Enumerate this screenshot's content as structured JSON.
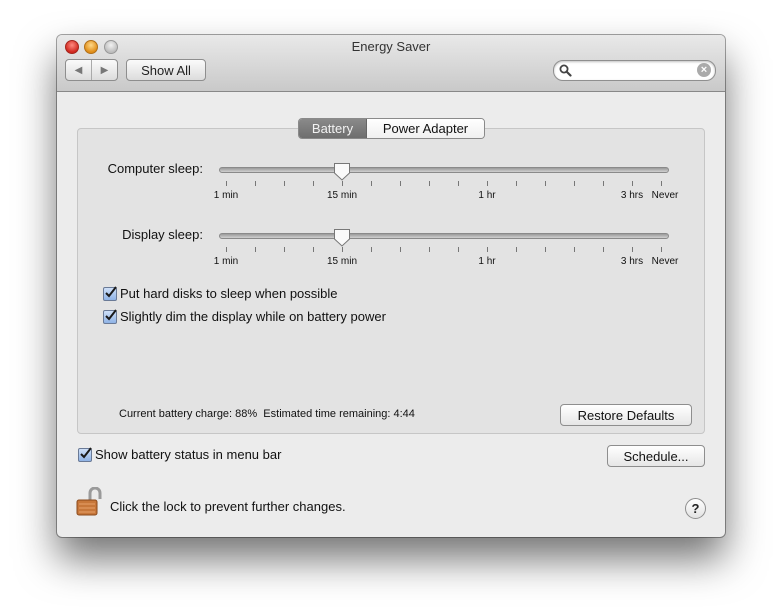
{
  "window": {
    "title": "Energy Saver",
    "toolbar": {
      "back_icon": "back-arrow-icon",
      "forward_icon": "forward-arrow-icon",
      "show_all_label": "Show All",
      "search_value": "",
      "search_placeholder": ""
    }
  },
  "tabs": [
    {
      "label": "Battery",
      "active": true
    },
    {
      "label": "Power Adapter",
      "active": false
    }
  ],
  "sliders": {
    "tick_labels": [
      "1 min",
      "15 min",
      "1 hr",
      "3 hrs",
      "Never"
    ],
    "tick_count": 16,
    "computer_sleep": {
      "label": "Computer sleep:",
      "value": "15 min"
    },
    "display_sleep": {
      "label": "Display sleep:",
      "value": "15 min"
    }
  },
  "checkboxes": [
    {
      "label": "Put hard disks to sleep when possible",
      "checked": true
    },
    {
      "label": "Slightly dim the display while on battery power",
      "checked": true
    }
  ],
  "status_text": "Current battery charge: 88%  Estimated time remaining: 4:44",
  "restore_defaults_label": "Restore Defaults",
  "show_battery_status": {
    "label": "Show battery status in menu bar",
    "checked": true
  },
  "schedule_label": "Schedule...",
  "lock_text": "Click the lock to prevent further changes.",
  "help_label": "?"
}
